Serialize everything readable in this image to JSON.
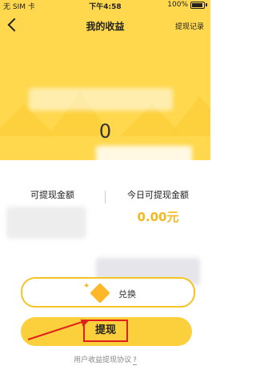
{
  "status_bar": {
    "carrier": "无 SIM 卡",
    "time": "下午4:58",
    "battery": "100%"
  },
  "nav": {
    "title": "我的收益",
    "action": "提现记录"
  },
  "balance": "0",
  "stats": {
    "left_label": "可提现金额",
    "right_label": "今日可提现金额",
    "right_value": "0.00元"
  },
  "exchange": {
    "label": "兑换"
  },
  "withdraw": {
    "label": "提现"
  },
  "agreement": {
    "text": "用户收益提现协议",
    "q": "?"
  },
  "colors": {
    "brand_yellow": "#FFD84D",
    "accent_orange": "#F5B81F",
    "highlight_red": "#E0201A"
  }
}
